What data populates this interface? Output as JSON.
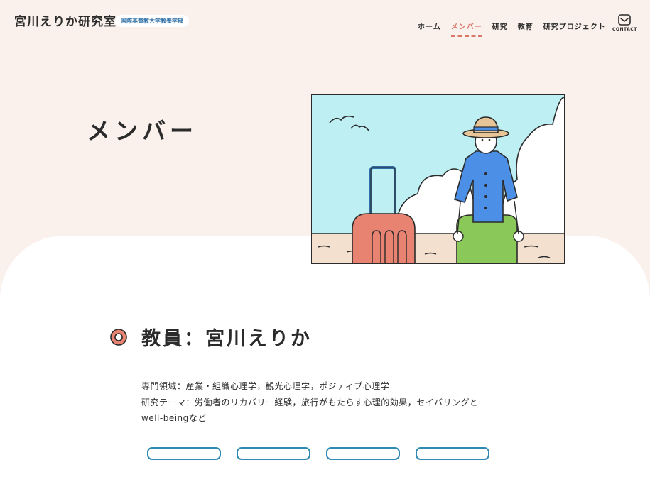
{
  "header": {
    "site_title": "宮川えりか研究室",
    "affiliation": "国際基督教大学教養学部",
    "nav": [
      {
        "label": "ホーム",
        "active": false
      },
      {
        "label": "メンバー",
        "active": true
      },
      {
        "label": "研究",
        "active": false
      },
      {
        "label": "教育",
        "active": false
      },
      {
        "label": "研究プロジェクト",
        "active": false
      }
    ],
    "contact": {
      "label": "CONTACT",
      "icon": "mail-icon"
    }
  },
  "page": {
    "title": "メンバー"
  },
  "hero": {
    "icon": "traveler-illustration"
  },
  "faculty": {
    "heading": "教員：宮川えりか",
    "field": "専門領域：産業・組織心理学，観光心理学，ポジティブ心理学",
    "theme_1": "研究テーマ：労働者のリカバリー経験，旅行がもたらす心理的効果，セイバリングと",
    "theme_2": "well-beingなど"
  },
  "colors": {
    "background": "#faf1ec",
    "accent": "#d9776b",
    "blue": "#2f6fa5",
    "sky": "#bdeff3",
    "text": "#2b2b2b"
  }
}
